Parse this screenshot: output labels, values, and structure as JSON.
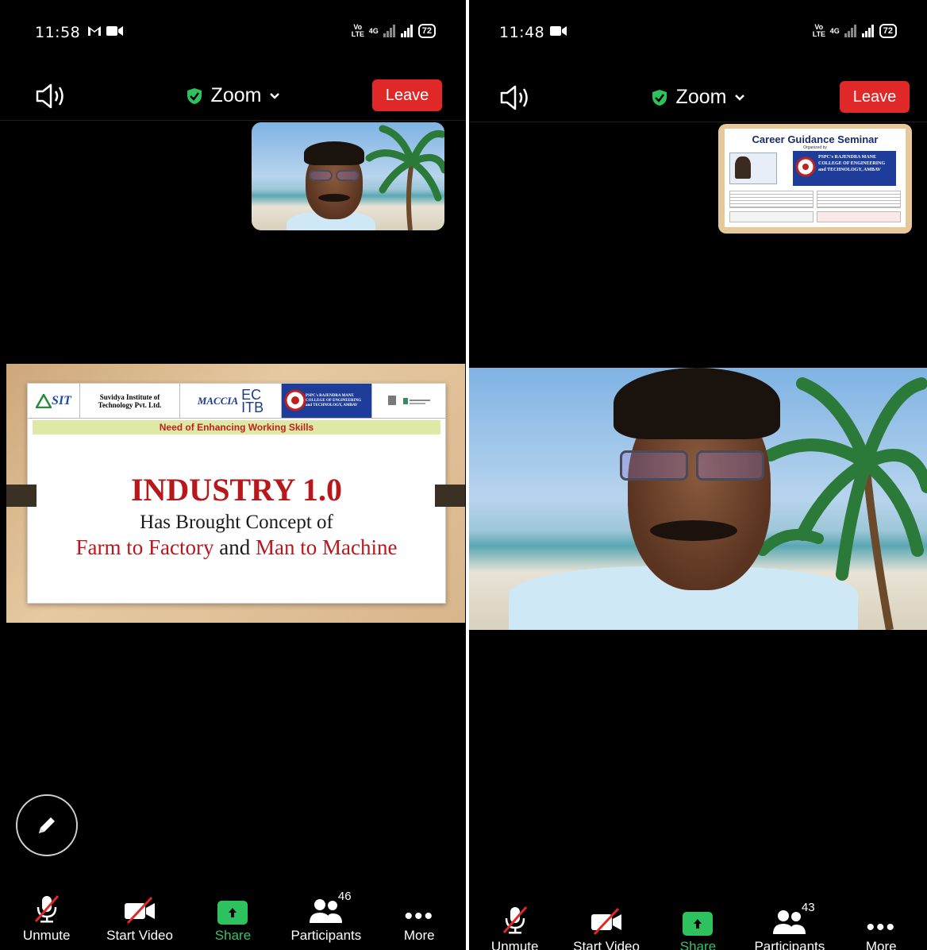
{
  "left_phone": {
    "status": {
      "time": "11:58",
      "net1": "Vo LTE",
      "net2": "4G",
      "battery": "72"
    },
    "meeting": {
      "title": "Zoom",
      "leave_label": "Leave"
    },
    "slide": {
      "logo_sit": "SIT",
      "org_name": "Suvidya Institute of Technology Pvt. Ltd.",
      "logo_maccia": "MACCIA",
      "logo_ecitb_1": "EC",
      "logo_ecitb_2": "ITB",
      "college_name": "PSPC's RAJENDRA MANE COLLEGE OF ENGINEERING and TECHNOLOGY, AMBAV",
      "subtitle": "Need of Enhancing Working Skills",
      "heading": "INDUSTRY 1.0",
      "line2": "Has Brought Concept of",
      "line3_a": "Farm to Factory",
      "line3_b": "and",
      "line3_c": "Man to Machine"
    },
    "toolbar": {
      "unmute": "Unmute",
      "start_video": "Start Video",
      "share": "Share",
      "participants": "Participants",
      "participants_count": "46",
      "more": "More"
    }
  },
  "right_phone": {
    "status": {
      "time": "11:48",
      "net1": "Vo LTE",
      "net2": "4G",
      "battery": "72"
    },
    "meeting": {
      "title": "Zoom",
      "leave_label": "Leave"
    },
    "seminar": {
      "title": "Career Guidance Seminar",
      "organized_by": "Organized by",
      "college": "PSPC's RAJENDRA MANE COLLEGE OF ENGINEERING and TECHNOLOGY, AMBAV"
    },
    "toolbar": {
      "unmute": "Unmute",
      "start_video": "Start Video",
      "share": "Share",
      "participants": "Participants",
      "participants_count": "43",
      "more": "More"
    }
  },
  "colors": {
    "leave": "#e02828",
    "share": "#2ec25e",
    "shield": "#2ec25e",
    "slide_red": "#b8181c"
  }
}
